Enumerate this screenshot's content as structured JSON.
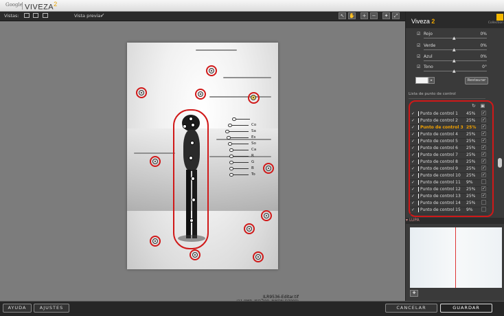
{
  "titlebar": {
    "google": "Google",
    "app": "VIVEZA",
    "version": "2"
  },
  "toolbar": {
    "views_label": "Vistas:",
    "preview_label": "Vista previa:",
    "preview_check": "✓"
  },
  "panel": {
    "title": "Viveza",
    "title_num": "2",
    "logo_text": "Collection",
    "adjustments": [
      {
        "name": "Rojo",
        "value": "0%"
      },
      {
        "name": "Verde",
        "value": "0%"
      },
      {
        "name": "Azul",
        "value": "0%"
      },
      {
        "name": "Tono",
        "value": "0°"
      }
    ],
    "restore_label": "Restaurar",
    "list_section": "Lista de punto de control",
    "items": [
      {
        "name": "Punto de control 1",
        "pct": "45%",
        "vis": "✓"
      },
      {
        "name": "Punto de control 2",
        "pct": "25%",
        "vis": "✓"
      },
      {
        "name": "Punto de control 3",
        "pct": "25%",
        "vis": "✓"
      },
      {
        "name": "Punto de control 4",
        "pct": "25%",
        "vis": "✓"
      },
      {
        "name": "Punto de control 5",
        "pct": "25%",
        "vis": "✓"
      },
      {
        "name": "Punto de control 6",
        "pct": "25%",
        "vis": "✓"
      },
      {
        "name": "Punto de control 7",
        "pct": "25%",
        "vis": "✓"
      },
      {
        "name": "Punto de control 8",
        "pct": "25%",
        "vis": "✓"
      },
      {
        "name": "Punto de control 9",
        "pct": "25%",
        "vis": "✓"
      },
      {
        "name": "Punto de control 10",
        "pct": "25%",
        "vis": "✓"
      },
      {
        "name": "Punto de control 11",
        "pct": "9%",
        "vis": ""
      },
      {
        "name": "Punto de control 12",
        "pct": "25%",
        "vis": "✓"
      },
      {
        "name": "Punto de control 13",
        "pct": "25%",
        "vis": "✓"
      },
      {
        "name": "Punto de control 14",
        "pct": "25%",
        "vis": ""
      },
      {
        "name": "Punto de control 15",
        "pct": "9%",
        "vis": ""
      }
    ],
    "lupa_label": "LUPA"
  },
  "sliders": [
    "",
    "Co",
    "Sa",
    "Es",
    "So",
    "Ca",
    "R",
    "G",
    "B",
    "To"
  ],
  "caption": {
    "file": "_ILR9536-Editar.tif",
    "info": "(11.9MP, ISO 100, NIKON D7000)"
  },
  "bottom": {
    "help": "AYUDA",
    "settings": "AJUSTES",
    "cancel": "CANCELAR",
    "save": "GUARDAR"
  },
  "colors": {
    "accent": "#f0a000",
    "highlight": "#d01818"
  }
}
